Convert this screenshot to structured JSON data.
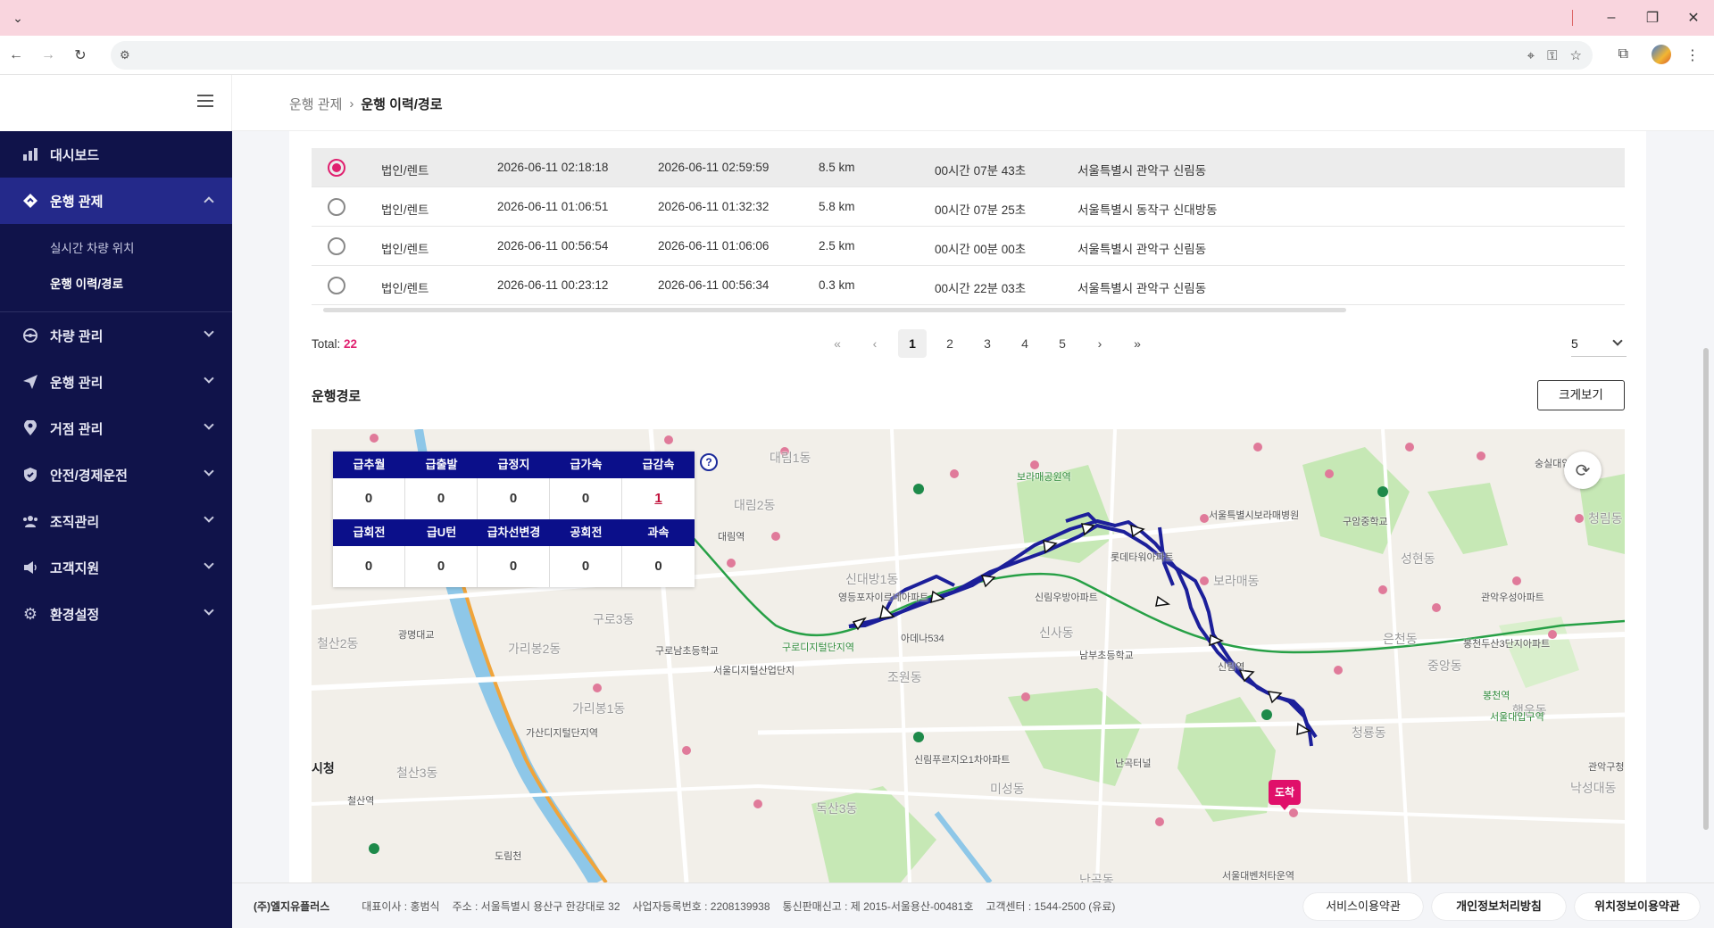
{
  "browser": {
    "menu_icon": "chevron-down-icon",
    "window_controls": [
      "minimize-icon",
      "restore-icon",
      "close-icon"
    ],
    "nav": [
      "back-icon",
      "forward-icon",
      "reload-icon"
    ],
    "omnibox_icons": [
      "location-icon",
      "key-icon",
      "star-icon"
    ]
  },
  "sidebar": {
    "items": [
      {
        "label": "대시보드",
        "icon": "dashboard-icon"
      },
      {
        "label": "운행 관제",
        "icon": "diamond-nav-icon",
        "active": true,
        "sub": [
          {
            "label": "실시간 차량 위치"
          },
          {
            "label": "운행 이력/경로",
            "active": true
          }
        ]
      },
      {
        "label": "차량 관리",
        "icon": "steering-icon"
      },
      {
        "label": "운행 관리",
        "icon": "send-icon"
      },
      {
        "label": "거점 관리",
        "icon": "pin-icon"
      },
      {
        "label": "안전/경제운전",
        "icon": "shield-icon"
      },
      {
        "label": "조직관리",
        "icon": "group-icon"
      },
      {
        "label": "고객지원",
        "icon": "speaker-icon"
      },
      {
        "label": "환경설정",
        "icon": "gear-icon"
      }
    ]
  },
  "breadcrumb": {
    "parent": "운행 관제",
    "sep": "›",
    "current": "운행 이력/경로"
  },
  "trips": [
    {
      "type": "법인/렌트",
      "start": "2026-06-11 02:18:18",
      "end": "2026-06-11 02:59:59",
      "distance": "8.5 km",
      "duration": "00시간 07분 43초",
      "location": "서울특별시 관악구 신림동",
      "selected": true
    },
    {
      "type": "법인/렌트",
      "start": "2026-06-11 01:06:51",
      "end": "2026-06-11 01:32:32",
      "distance": "5.8 km",
      "duration": "00시간 07분 25초",
      "location": "서울특별시 동작구 신대방동",
      "selected": false
    },
    {
      "type": "법인/렌트",
      "start": "2026-06-11 00:56:54",
      "end": "2026-06-11 01:06:06",
      "distance": "2.5 km",
      "duration": "00시간 00분 00초",
      "location": "서울특별시 관악구 신림동",
      "selected": false
    },
    {
      "type": "법인/렌트",
      "start": "2026-06-11 00:23:12",
      "end": "2026-06-11 00:56:34",
      "distance": "0.3 km",
      "duration": "00시간 22분 03초",
      "location": "서울특별시 관악구 신림동",
      "selected": false
    }
  ],
  "total": {
    "label": "Total:",
    "value": "22"
  },
  "pagination": {
    "first": "«",
    "prev": "‹",
    "pages": [
      "1",
      "2",
      "3",
      "4",
      "5"
    ],
    "current": "1",
    "next": "›",
    "last": "»"
  },
  "page_size": "5",
  "route": {
    "title": "운행경로",
    "enlarge_label": "크게보기",
    "arrival_label": "도착"
  },
  "events": {
    "row1": [
      {
        "h": "급추월",
        "v": "0"
      },
      {
        "h": "급출발",
        "v": "0"
      },
      {
        "h": "급정지",
        "v": "0"
      },
      {
        "h": "급가속",
        "v": "0"
      },
      {
        "h": "급감속",
        "v": "1"
      }
    ],
    "row2": [
      {
        "h": "급회전",
        "v": "0"
      },
      {
        "h": "급U턴",
        "v": "0"
      },
      {
        "h": "급차선변경",
        "v": "0"
      },
      {
        "h": "공회전",
        "v": "0"
      },
      {
        "h": "과속",
        "v": "0"
      }
    ],
    "help": "?"
  },
  "map_labels": [
    "대림동",
    "대림1동",
    "대림2동",
    "신대방1동",
    "신사동",
    "구로3동",
    "가리봉2동",
    "가리봉1동",
    "철산2동",
    "철산3동",
    "독산3동",
    "조원동",
    "미성동",
    "보라매동",
    "성현동",
    "은천동",
    "중앙동",
    "청룡동",
    "행운동",
    "낙성대동",
    "청림동",
    "난곡동",
    "대림역",
    "구로디지털단지역",
    "가산디지털단지역",
    "신림역",
    "보라매공원역",
    "봉천역",
    "서울대입구역",
    "철산역",
    "서울대벤처타운역",
    "숭실대입구역",
    "영등포자이르네아파트",
    "신림우방아파트",
    "롯데타워아파트",
    "관악우성아파트",
    "남부초등학교",
    "구로남초등학교",
    "서울디지털산업단지",
    "신림푸르지오1차아파트",
    "서울특별시보라매병원",
    "관악구청",
    "구암중학교",
    "봉천두산3단지아파트",
    "아데나534",
    "광명대교",
    "시청",
    "난곡터널",
    "도림천"
  ],
  "map_colors": {
    "route": "#1c1f9a",
    "arrival": "#e0106a",
    "subway_green": "#27a046",
    "river": "#8ec7e8",
    "park": "#c6e8b5"
  },
  "footer": {
    "company": "(주)엘지유플러스",
    "ceo": "대표이사 : 홍범식",
    "address": "주소 : 서울특별시 용산구 한강대로 32",
    "biz": "사업자등록번호 : 2208139938",
    "telecom": "통신판매신고 : 제 2015-서울용산-00481호",
    "center": "고객센터 : 1544-2500 (유료)",
    "links": [
      "서비스이용약관",
      "개인정보처리방침",
      "위치정보이용약관"
    ]
  }
}
